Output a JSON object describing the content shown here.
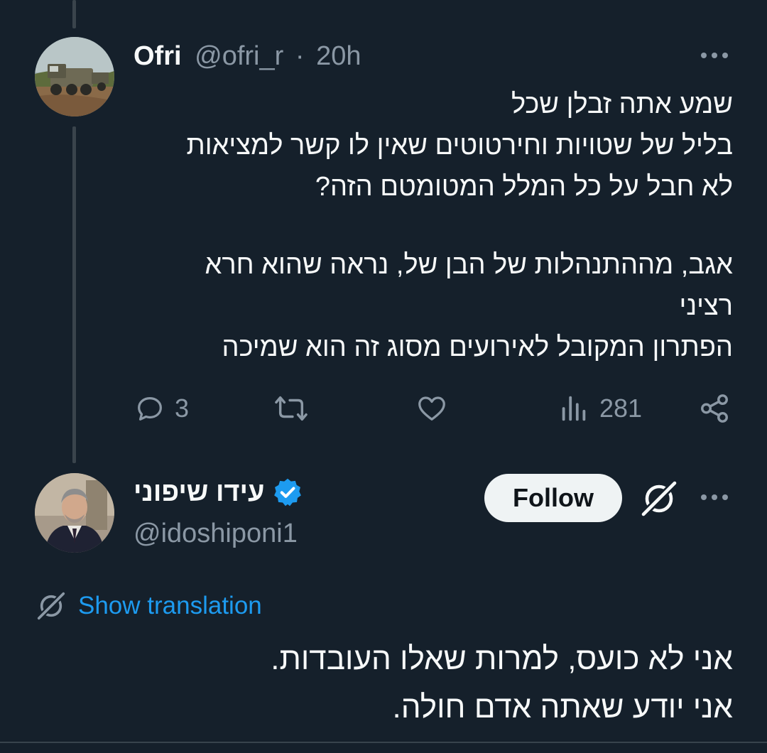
{
  "tweet1": {
    "name": "Ofri",
    "handle": "@ofri_r",
    "separator": "·",
    "time": "20h",
    "avatar_icon": "military-truck-avatar",
    "text_block_1": "שמע אתה זבלן שכל\nבליל של שטויות וחירטוטים שאין לו קשר למציאות\nלא חבל על כל המלל המטומטם הזה?",
    "text_block_2": "אגב, מההתנהלות של הבן של, נראה שהוא חרא\nרציני\nהפתרון המקובל לאירועים מסוג זה הוא שמיכה",
    "actions": {
      "reply_count": "3",
      "retweet_count": "",
      "like_count": "",
      "views_count": "281"
    }
  },
  "tweet2": {
    "name": "עידו שיפוני",
    "handle": "@idoshiponi1",
    "verified": true,
    "follow_label": "Follow",
    "show_translation_label": "Show translation",
    "text": "אני לא כועס, למרות שאלו העובדות.\nאני יודע שאתה אדם חולה."
  },
  "colors": {
    "background": "#15202b",
    "text": "#f7f9f9",
    "muted": "#8b98a5",
    "link": "#1d9bf0",
    "verified": "#1d9bf0",
    "thread_line": "#3a444c"
  }
}
